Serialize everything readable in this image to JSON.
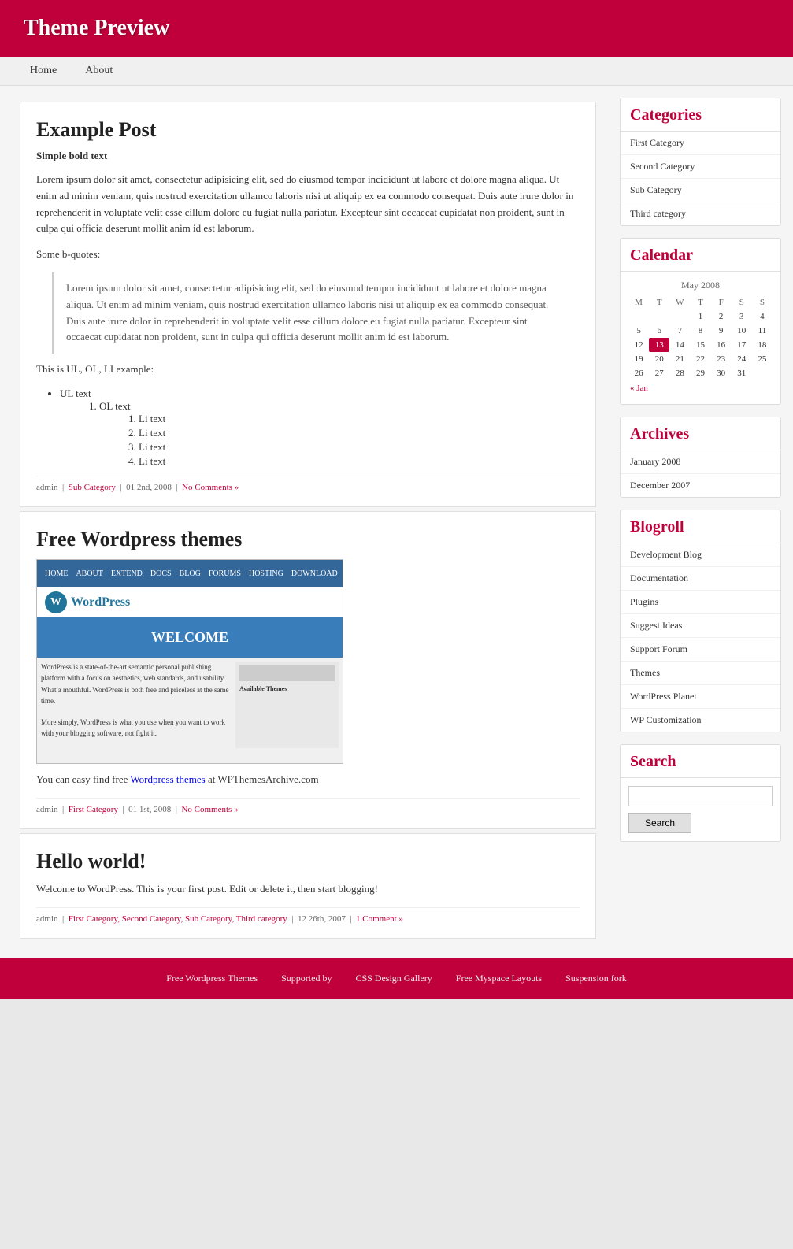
{
  "header": {
    "title": "Theme Preview"
  },
  "nav": {
    "items": [
      {
        "label": "Home",
        "href": "#"
      },
      {
        "label": "About",
        "href": "#"
      }
    ]
  },
  "posts": [
    {
      "id": "example-post",
      "title": "Example Post",
      "simple_bold": "Simple bold text",
      "body_intro": "Lorem ipsum dolor sit amet, consectetur adipisicing elit, sed do eiusmod tempor incididunt ut labore et dolore magna aliqua. Ut enim ad minim veniam, quis nostrud exercitation ullamco laboris nisi ut aliquip ex ea commodo consequat. Duis aute irure dolor in reprehenderit in voluptate velit esse cillum dolore eu fugiat nulla pariatur. Excepteur sint occaecat cupidatat non proident, sunt in culpa qui officia deserunt mollit anim id est laborum.",
      "bquotes_label": "Some b-quotes:",
      "blockquote": "Lorem ipsum dolor sit amet, consectetur adipisicing elit, sed do eiusmod tempor incididunt ut labore et dolore magna aliqua. Ut enim ad minim veniam, quis nostrud exercitation ullamco laboris nisi ut aliquip ex ea commodo consequat. Duis aute irure dolor in reprehenderit in voluptate velit esse cillum dolore eu fugiat nulla pariatur. Excepteur sint occaecat cupidatat non proident, sunt in culpa qui officia deserunt mollit anim id est laborum.",
      "list_label": "This is UL, OL, LI example:",
      "ul_text": "UL text",
      "ol_text": "OL text",
      "li_items": [
        "Li text",
        "Li text",
        "Li text",
        "Li text"
      ],
      "meta_author": "admin",
      "meta_category": "Sub Category",
      "meta_date": "01 2nd, 2008",
      "meta_comments": "No Comments »"
    },
    {
      "id": "free-wordpress",
      "title": "Free Wordpress themes",
      "body_text": "You can easy find free Wordpress themes at WPThemesArchive.com",
      "body_link": "Wordpress themes",
      "meta_author": "admin",
      "meta_category": "First Category",
      "meta_date": "01 1st, 2008",
      "meta_comments": "No Comments »"
    },
    {
      "id": "hello-world",
      "title": "Hello world!",
      "body_text": "Welcome to WordPress. This is your first post. Edit or delete it, then start blogging!",
      "meta_author": "admin",
      "meta_categories": "First Category, Second Category, Sub Category, Third category",
      "meta_date": "12 26th, 2007",
      "meta_comments": "1 Comment »"
    }
  ],
  "sidebar": {
    "categories": {
      "title": "Categories",
      "items": [
        {
          "label": "First Category"
        },
        {
          "label": "Second Category"
        },
        {
          "label": "Sub Category"
        },
        {
          "label": "Third category"
        }
      ]
    },
    "calendar": {
      "title": "Calendar",
      "month": "May 2008",
      "days_header": [
        "M",
        "T",
        "W",
        "T",
        "F",
        "S",
        "S"
      ],
      "weeks": [
        [
          null,
          null,
          null,
          "1",
          "2",
          "3",
          "4"
        ],
        [
          "5",
          "6",
          "7",
          "8",
          "9",
          "10",
          "11"
        ],
        [
          "12",
          "13",
          "14",
          "15",
          "16",
          "17",
          "18"
        ],
        [
          "19",
          "20",
          "21",
          "22",
          "23",
          "24",
          "25"
        ],
        [
          "26",
          "27",
          "28",
          "29",
          "30",
          "31",
          null
        ]
      ],
      "today": "13",
      "prev_label": "« Jan"
    },
    "archives": {
      "title": "Archives",
      "items": [
        {
          "label": "January 2008"
        },
        {
          "label": "December 2007"
        }
      ]
    },
    "blogroll": {
      "title": "Blogroll",
      "items": [
        {
          "label": "Development Blog"
        },
        {
          "label": "Documentation"
        },
        {
          "label": "Plugins"
        },
        {
          "label": "Suggest Ideas"
        },
        {
          "label": "Support Forum"
        },
        {
          "label": "Themes"
        },
        {
          "label": "WordPress Planet"
        },
        {
          "label": "WP Customization"
        }
      ]
    },
    "search": {
      "title": "Search",
      "placeholder": "",
      "button_label": "Search"
    }
  },
  "footer": {
    "links": [
      {
        "label": "Free Wordpress Themes"
      },
      {
        "label": "Supported by"
      },
      {
        "label": "CSS Design Gallery"
      },
      {
        "label": "Free Myspace Layouts"
      },
      {
        "label": "Suspension fork"
      }
    ]
  }
}
